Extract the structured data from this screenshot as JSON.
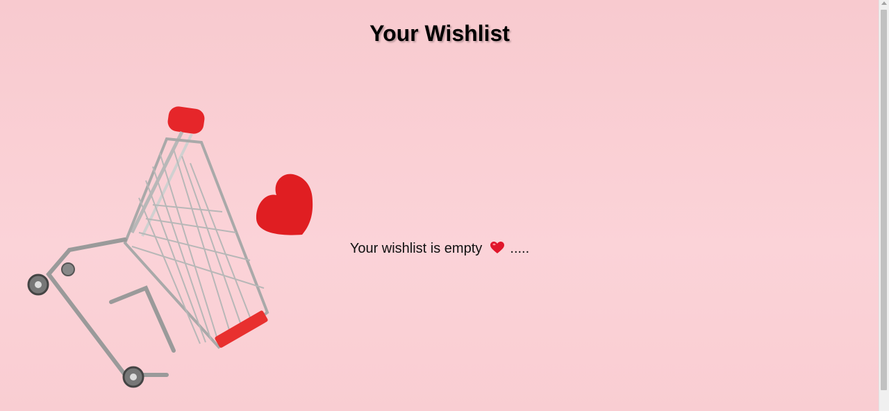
{
  "page": {
    "title": "Your Wishlist",
    "empty_message": "Your wishlist is empty",
    "empty_suffix": ".....",
    "icons": {
      "message_icon": "red-heart-icon",
      "illustration": "shopping-cart-with-heart-illustration"
    }
  },
  "colors": {
    "background": "#f9cdd2",
    "accent_red": "#e01e22",
    "text": "#111111"
  }
}
